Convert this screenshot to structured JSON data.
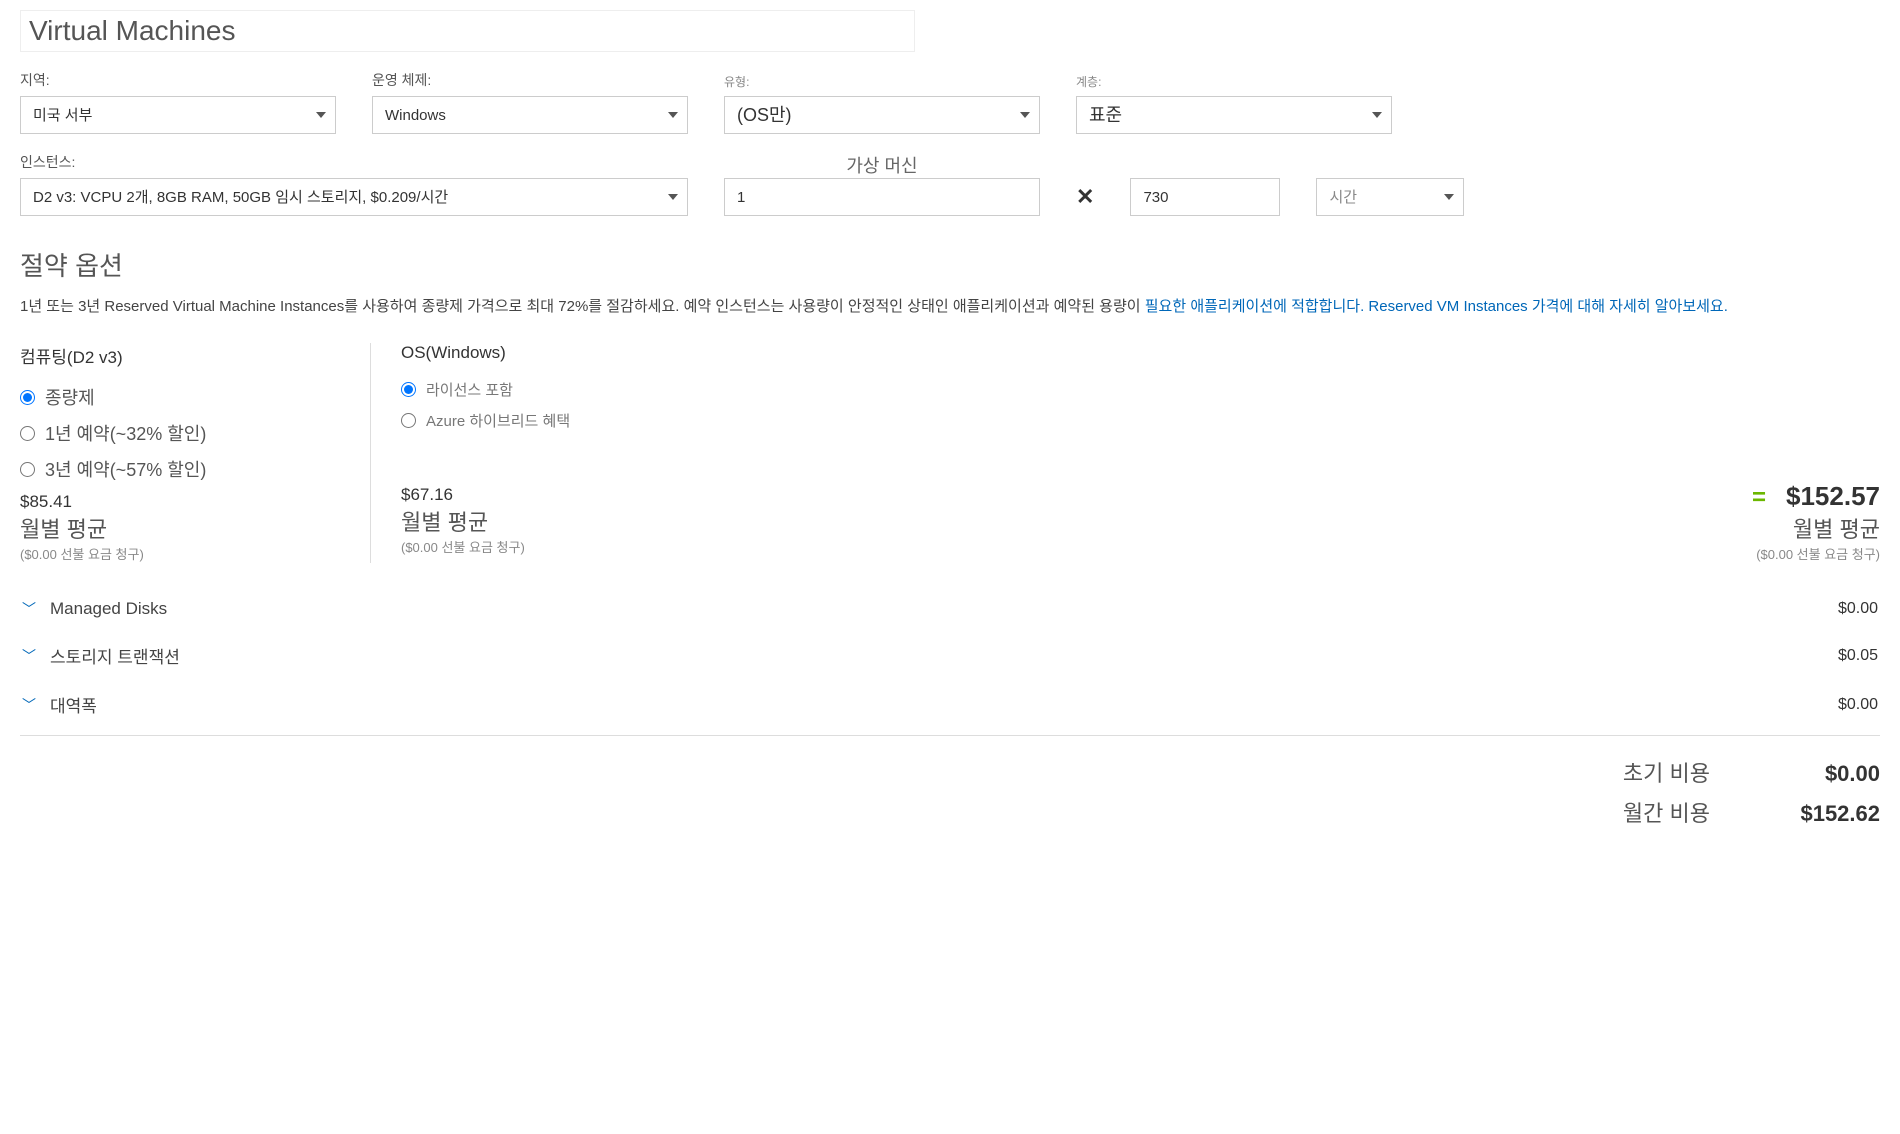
{
  "title": "Virtual Machines",
  "fields": {
    "region": {
      "label": "지역:",
      "value": "미국 서부"
    },
    "os": {
      "label": "운영 체제:",
      "value": "Windows"
    },
    "type": {
      "label": "유형:",
      "value": "(OS만)"
    },
    "tier": {
      "label": "계층:",
      "value": "표준"
    },
    "instance": {
      "label": "인스턴스:",
      "value": "D2 v3: VCPU 2개, 8GB RAM, 50GB 임시 스토리지, $0.209/시간"
    },
    "vm_header": "가상 머신",
    "vm_count": "1",
    "hours": "730",
    "time_unit": "시간"
  },
  "savings": {
    "title": "절약 옵션",
    "desc_part1": "1년 또는 3년 Reserved Virtual Machine Instances를 사용하여 종량제 가격으로 최대 72%를 절감하세요. 예약 인스턴스는 사용량이 안정적인 상태인 애플리케이션과 예약된 용량이 ",
    "desc_part2": "필요한 애플리케이션에 적합합니다. Reserved VM Instances 가격에 대해 자세히 알아보세요.",
    "compute": {
      "title": "컴퓨팅(D2 v3)",
      "options": {
        "payg": "종량제",
        "y1": "1년 예약(~32% 할인)",
        "y3": "3년 예약(~57% 할인)"
      },
      "price": "$85.41",
      "price_label": "월별 평균",
      "price_sub": "($0.00 선불 요금 청구)"
    },
    "os": {
      "title": "OS(Windows)",
      "options": {
        "included": "라이선스 포함",
        "hybrid": "Azure 하이브리드 혜택"
      },
      "price": "$67.16",
      "price_label": "월별 평균",
      "price_sub": "($0.00 선불 요금 청구)"
    },
    "total": {
      "value": "$152.57",
      "label": "월별 평균",
      "sub": "($0.00 선불 요금 청구)"
    }
  },
  "expandables": {
    "disks": {
      "label": "Managed Disks",
      "price": "$0.00"
    },
    "storage": {
      "label": "스토리지 트랜잭션",
      "price": "$0.05"
    },
    "bandwidth": {
      "label": "대역폭",
      "price": "$0.00"
    }
  },
  "summary": {
    "upfront": {
      "label": "초기 비용",
      "value": "$0.00"
    },
    "monthly": {
      "label": "월간 비용",
      "value": "$152.62"
    }
  }
}
